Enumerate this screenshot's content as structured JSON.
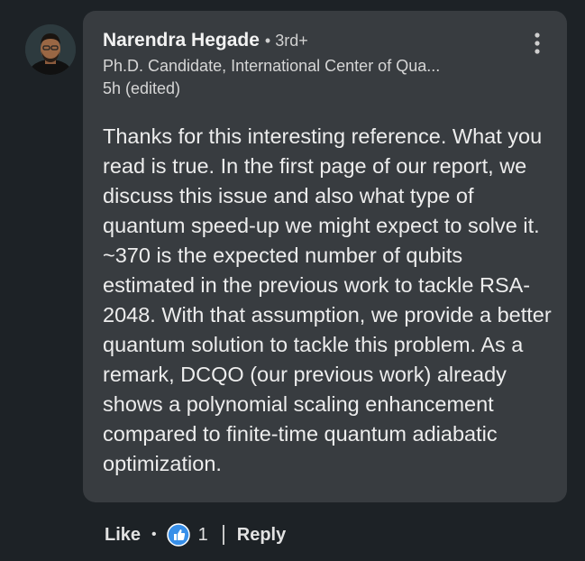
{
  "comment": {
    "author": "Narendra Hegade",
    "degree_separator": "•",
    "degree": "3rd+",
    "headline": "Ph.D. Candidate, International Center of Qua...",
    "timestamp": "5h (edited)",
    "text": "Thanks for this interesting reference. What you read is true. In the first page of our report, we discuss this issue and also what type of quantum speed-up we might expect to solve it. ~370 is the expected number of qubits estimated in the previous work to tackle RSA-2048. With that assumption, we provide a better quantum solution to tackle this problem. As a remark, DCQO (our previous work) already shows a polynomial scaling enhancement compared to finite-time quantum adiabatic optimization."
  },
  "actions": {
    "like_label": "Like",
    "separator": "•",
    "like_count": "1",
    "reply_label": "Reply"
  },
  "icons": {
    "avatar": "profile-photo",
    "more": "more-vertical-icon",
    "reaction": "thumbs-up-icon"
  },
  "colors": {
    "background": "#1d2226",
    "bubble": "#383c40",
    "like_blue": "#378fe9"
  }
}
